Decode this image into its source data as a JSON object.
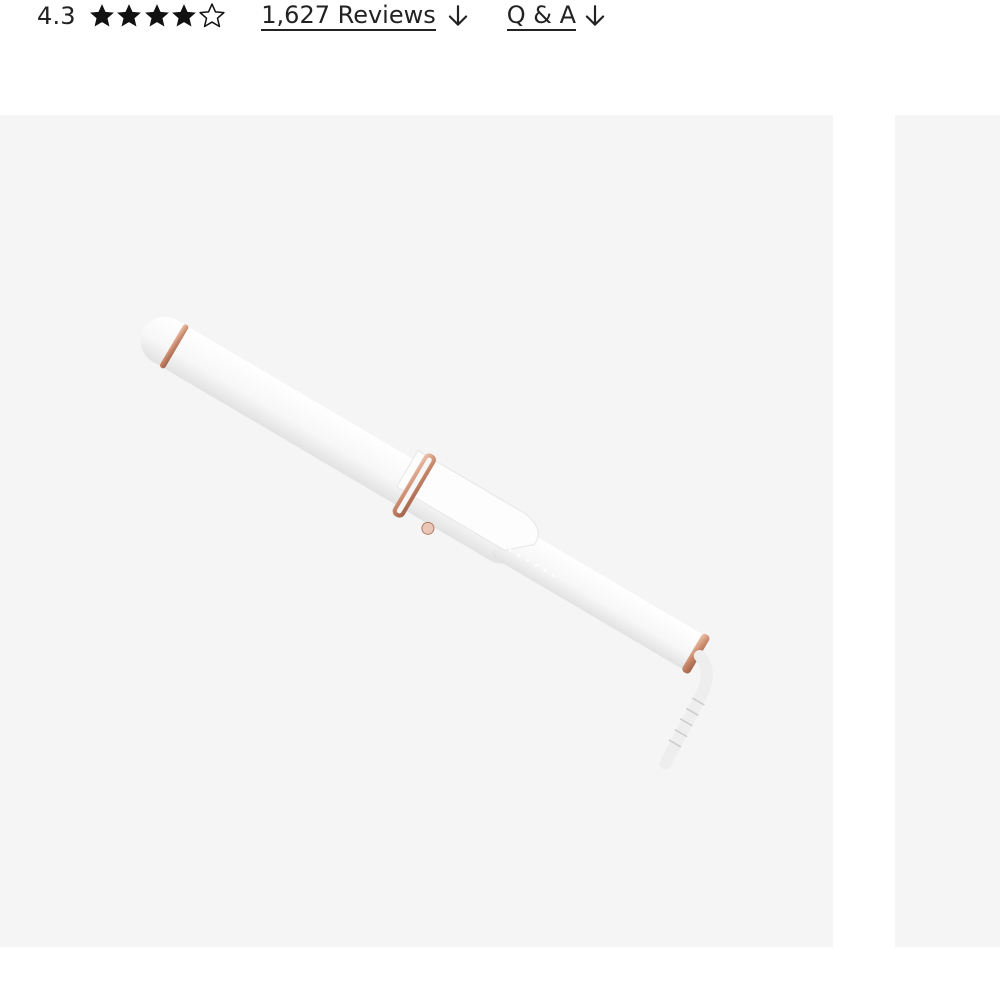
{
  "rating": {
    "value": "4.3",
    "score": 4.3,
    "max_stars": 5,
    "filled_stars": 4,
    "reviews_label": "1,627 Reviews",
    "qa_label": "Q & A",
    "arrow_icon": "arrow-down-icon",
    "star_icons": [
      "star-filled-icon",
      "star-filled-icon",
      "star-filled-icon",
      "star-filled-icon",
      "star-outline-icon"
    ]
  },
  "gallery": {
    "main_image": "product-image-curling-iron",
    "next_image": "product-image-next",
    "background_color": "#f5f5f5"
  },
  "colors": {
    "text": "#222222",
    "accent_rose_gold": "#c98a6b",
    "product_white": "#fafafa"
  }
}
